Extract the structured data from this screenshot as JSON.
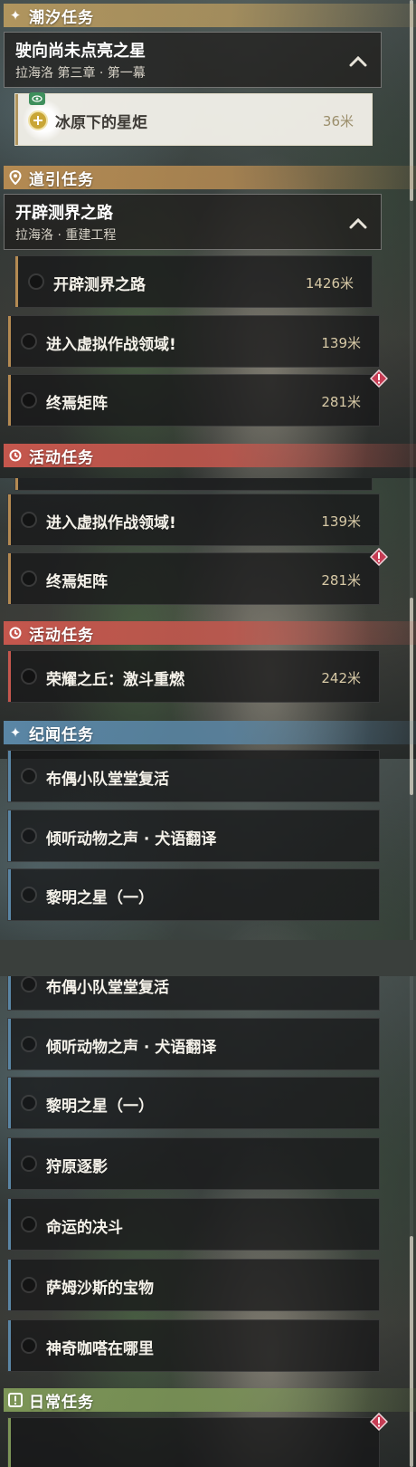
{
  "colors": {
    "tide": "#b0955e",
    "guide": "#b48a52",
    "event": "#c5574d",
    "lore": "#5a86a5",
    "daily": "#7c9557",
    "gold_dist": "#d7c9a6"
  },
  "panel1": {
    "tide_header": {
      "icon": "sparkle-icon",
      "label": "潮汐任务"
    },
    "tide_group": {
      "title": "驶向尚未点亮之星",
      "subtitle": "拉海洛 第三章 · 第一幕"
    },
    "tide_task": {
      "name": "冰原下的星炬",
      "distance": "36米"
    },
    "guide_header": {
      "icon": "location-pin-icon",
      "label": "道引任务"
    },
    "guide_group": {
      "title": "开辟测界之路",
      "subtitle": "拉海洛 · 重建工程"
    },
    "guide_tasks": [
      {
        "name": "开辟测界之路",
        "distance": "1426米"
      },
      {
        "name": "进入虚拟作战领域!",
        "distance": "139米"
      },
      {
        "name": "终焉矩阵",
        "distance": "281米"
      }
    ],
    "event_header_partial": {
      "label": "活动任务"
    }
  },
  "panel2": {
    "guide_tasks": [
      {
        "name": "进入虚拟作战领域!",
        "distance": "139米"
      },
      {
        "name": "终焉矩阵",
        "distance": "281米"
      }
    ],
    "event_header": {
      "icon": "event-icon",
      "label": "活动任务"
    },
    "event_tasks": [
      {
        "name": "荣耀之丘：激斗重燃",
        "distance": "242米"
      }
    ],
    "lore_header": {
      "icon": "sparkle-icon",
      "label": "纪闻任务"
    },
    "lore_tasks": [
      {
        "name": "布偶小队堂堂复活"
      },
      {
        "name": "倾听动物之声 · 犬语翻译"
      },
      {
        "name": "黎明之星（一）"
      }
    ]
  },
  "panel3": {
    "lore_tasks": [
      {
        "name": "布偶小队堂堂复活"
      },
      {
        "name": "倾听动物之声 · 犬语翻译"
      },
      {
        "name": "黎明之星（一）"
      },
      {
        "name": "狩原逐影"
      },
      {
        "name": "命运的决斗"
      },
      {
        "name": "萨姆沙斯的宝物"
      },
      {
        "name": "神奇咖嗒在哪里"
      }
    ],
    "daily_header": {
      "icon": "exclamation-icon",
      "label": "日常任务"
    }
  }
}
